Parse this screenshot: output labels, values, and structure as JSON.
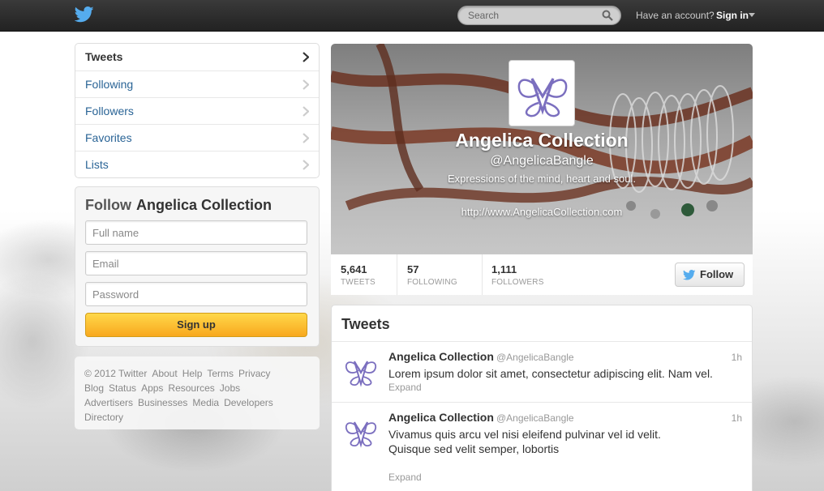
{
  "topbar": {
    "search_placeholder": "Search",
    "have_account": "Have an account?",
    "sign_in": "Sign in"
  },
  "nav": {
    "items": [
      {
        "label": "Tweets"
      },
      {
        "label": "Following"
      },
      {
        "label": "Followers"
      },
      {
        "label": "Favorites"
      },
      {
        "label": "Lists"
      }
    ]
  },
  "follow_box": {
    "follow_word": "Follow",
    "name": "Angelica Collection",
    "full_name_placeholder": "Full name",
    "email_placeholder": "Email",
    "password_placeholder": "Password",
    "signup_label": "Sign up"
  },
  "footer": {
    "links": [
      "© 2012 Twitter",
      "About",
      "Help",
      "Terms",
      "Privacy",
      "Blog",
      "Status",
      "Apps",
      "Resources",
      "Jobs",
      "Advertisers",
      "Businesses",
      "Media",
      "Developers",
      "Directory"
    ]
  },
  "profile": {
    "name": "Angelica Collection",
    "handle": "@AngelicaBangle",
    "bio": "Expressions of the mind, heart and soul.",
    "url": "http://www.AngelicaCollection.com",
    "stats": [
      {
        "num": "5,641",
        "label": "TWEETS"
      },
      {
        "num": "57",
        "label": "FOLLOWING"
      },
      {
        "num": "1,111",
        "label": "FOLLOWERS"
      }
    ],
    "follow_label": "Follow"
  },
  "tweets": {
    "title": "Tweets",
    "items": [
      {
        "name": "Angelica Collection",
        "handle": "@AngelicaBangle",
        "time": "1h",
        "line1": "Lorem ipsum dolor sit amet, consectetur adipiscing elit. Nam vel.",
        "line2": "",
        "expand": "Expand"
      },
      {
        "name": "Angelica Collection",
        "handle": "@AngelicaBangle",
        "time": "1h",
        "line1": "Vivamus quis arcu vel nisi eleifend pulvinar vel id velit.",
        "line2": "Quisque sed velit semper, lobortis",
        "expand": "Expand"
      }
    ]
  },
  "colors": {
    "brand_blue": "#55acee",
    "link_blue": "#2a6496",
    "logo_purple": "#7b6fbf",
    "signup_yellow": "#f8a81e"
  }
}
